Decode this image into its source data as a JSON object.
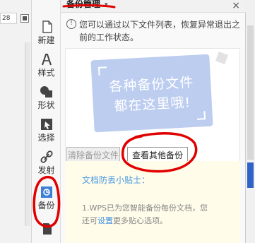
{
  "doc": {
    "ruler_value": "28"
  },
  "sidebar": {
    "items": [
      {
        "label": "新建",
        "icon": "new-doc-icon"
      },
      {
        "label": "样式",
        "icon": "style-icon"
      },
      {
        "label": "形状",
        "icon": "shape-icon"
      },
      {
        "label": "选择",
        "icon": "select-icon"
      },
      {
        "label": "发射",
        "icon": "link-icon"
      },
      {
        "label": "备份",
        "icon": "backup-icon"
      }
    ]
  },
  "panel": {
    "title": "备份管理",
    "dropdown_glyph": "▾",
    "close_glyph": "×",
    "notice": "您可以通过以下文件列表，恢复异常退出之前的工作状态。",
    "bubble_line1": "各种备份文件",
    "bubble_line2": "都在这里哦!",
    "clear_button": "清除备份文件",
    "view_button": "查看其他备份",
    "tips_title": "文档防丢小贴士：",
    "tips_line1": "1.WPS已为您智能备份每份文档，您",
    "tips_line2_pre": "还可",
    "tips_link": "设置",
    "tips_line2_post": "更多贴心选项。"
  },
  "colors": {
    "accent": "#3b8de0",
    "bubble": "#bccdf0",
    "annotation": "#e00000"
  }
}
